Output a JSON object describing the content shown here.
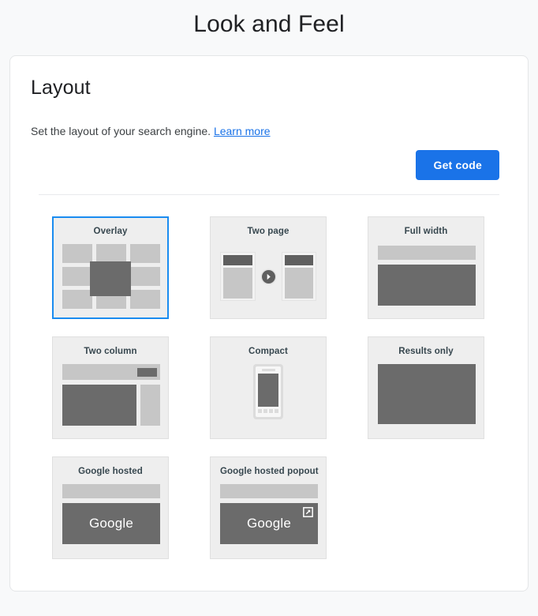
{
  "page": {
    "heading": "Look and Feel",
    "background_color": "#f8f9fa"
  },
  "panel": {
    "title": "Layout",
    "description": "Set the layout of your search engine.",
    "learn_more_label": "Learn more",
    "get_code_label": "Get code",
    "accent_color": "#1a73e8",
    "selected_border_color": "#1a8cf0"
  },
  "layout_options": [
    {
      "id": "overlay",
      "label": "Overlay",
      "selected": true
    },
    {
      "id": "two-page",
      "label": "Two page",
      "selected": false
    },
    {
      "id": "full-width",
      "label": "Full width",
      "selected": false
    },
    {
      "id": "two-column",
      "label": "Two column",
      "selected": false
    },
    {
      "id": "compact",
      "label": "Compact",
      "selected": false
    },
    {
      "id": "results-only",
      "label": "Results only",
      "selected": false
    },
    {
      "id": "google-hosted",
      "label": "Google hosted",
      "selected": false
    },
    {
      "id": "google-hosted-popout",
      "label": "Google hosted popout",
      "selected": false
    }
  ],
  "thumbnails": {
    "google_wordmark": "Google",
    "icons": {
      "two_page_arrow": "arrow-right-circle-icon",
      "popout": "external-link-icon"
    }
  }
}
